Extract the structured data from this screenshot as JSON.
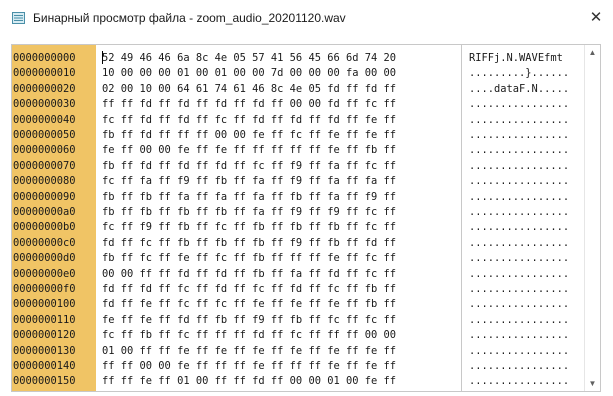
{
  "window": {
    "title": "Бинарный просмотр файла - zoom_audio_20201120.wav",
    "close_glyph": "✕",
    "icon": "hex-viewer-app-icon"
  },
  "colors": {
    "offset_background": "#f0c465",
    "frame_border": "#c8c8c8"
  },
  "viewer": {
    "rows": [
      {
        "offset": "0000000000",
        "hex": "52 49 46 46 6a 8c 4e 05 57 41 56 45 66 6d 74 20",
        "ascii": "RIFFj.N.WAVEfmt "
      },
      {
        "offset": "0000000010",
        "hex": "10 00 00 00 01 00 01 00 00 7d 00 00 00 fa 00 00",
        "ascii": ".........}......"
      },
      {
        "offset": "0000000020",
        "hex": "02 00 10 00 64 61 74 61 46 8c 4e 05 fd ff fd ff",
        "ascii": "....dataF.N....."
      },
      {
        "offset": "0000000030",
        "hex": "ff ff fd ff fd ff fd ff fd ff 00 00 fd ff fc ff",
        "ascii": "................"
      },
      {
        "offset": "0000000040",
        "hex": "fc ff fd ff fd ff fc ff fd ff fd ff fd ff fe ff",
        "ascii": "................"
      },
      {
        "offset": "0000000050",
        "hex": "fb ff fd ff ff ff 00 00 fe ff fc ff fe ff fe ff",
        "ascii": "................"
      },
      {
        "offset": "0000000060",
        "hex": "fe ff 00 00 fe ff fe ff ff ff ff ff fe ff fb ff",
        "ascii": "................"
      },
      {
        "offset": "0000000070",
        "hex": "fb ff fd ff fd ff fd ff fc ff f9 ff fa ff fc ff",
        "ascii": "................"
      },
      {
        "offset": "0000000080",
        "hex": "fc ff fa ff f9 ff fb ff fa ff f9 ff fa ff fa ff",
        "ascii": "................"
      },
      {
        "offset": "0000000090",
        "hex": "fb ff fb ff fa ff fa ff fa ff fb ff fa ff f9 ff",
        "ascii": "................"
      },
      {
        "offset": "00000000a0",
        "hex": "fb ff fb ff fb ff fb ff fa ff f9 ff f9 ff fc ff",
        "ascii": "................"
      },
      {
        "offset": "00000000b0",
        "hex": "fc ff f9 ff fb ff fc ff fb ff fb ff fb ff fc ff",
        "ascii": "................"
      },
      {
        "offset": "00000000c0",
        "hex": "fd ff fc ff fb ff fb ff fb ff f9 ff fb ff fd ff",
        "ascii": "................"
      },
      {
        "offset": "00000000d0",
        "hex": "fb ff fc ff fe ff fc ff fb ff ff ff fe ff fc ff",
        "ascii": "................"
      },
      {
        "offset": "00000000e0",
        "hex": "00 00 ff ff fd ff fd ff fb ff fa ff fd ff fc ff",
        "ascii": "................"
      },
      {
        "offset": "00000000f0",
        "hex": "fd ff fd ff fc ff fd ff fc ff fd ff fc ff fb ff",
        "ascii": "................"
      },
      {
        "offset": "0000000100",
        "hex": "fd ff fe ff fc ff fc ff fe ff fe ff fe ff fb ff",
        "ascii": "................"
      },
      {
        "offset": "0000000110",
        "hex": "fe ff fe ff fd ff fb ff f9 ff fb ff fc ff fc ff",
        "ascii": "................"
      },
      {
        "offset": "0000000120",
        "hex": "fc ff fb ff fc ff ff ff fd ff fc ff ff ff 00 00",
        "ascii": "................"
      },
      {
        "offset": "0000000130",
        "hex": "01 00 ff ff fe ff fe ff fe ff fe ff fe ff fe ff",
        "ascii": "................"
      },
      {
        "offset": "0000000140",
        "hex": "ff ff 00 00 fe ff ff ff fe ff ff ff fe ff fe ff",
        "ascii": "................"
      },
      {
        "offset": "0000000150",
        "hex": "ff ff fe ff 01 00 ff ff fd ff 00 00 01 00 fe ff",
        "ascii": "................"
      }
    ]
  },
  "scrollbar": {
    "up_glyph": "▲",
    "down_glyph": "▼"
  }
}
